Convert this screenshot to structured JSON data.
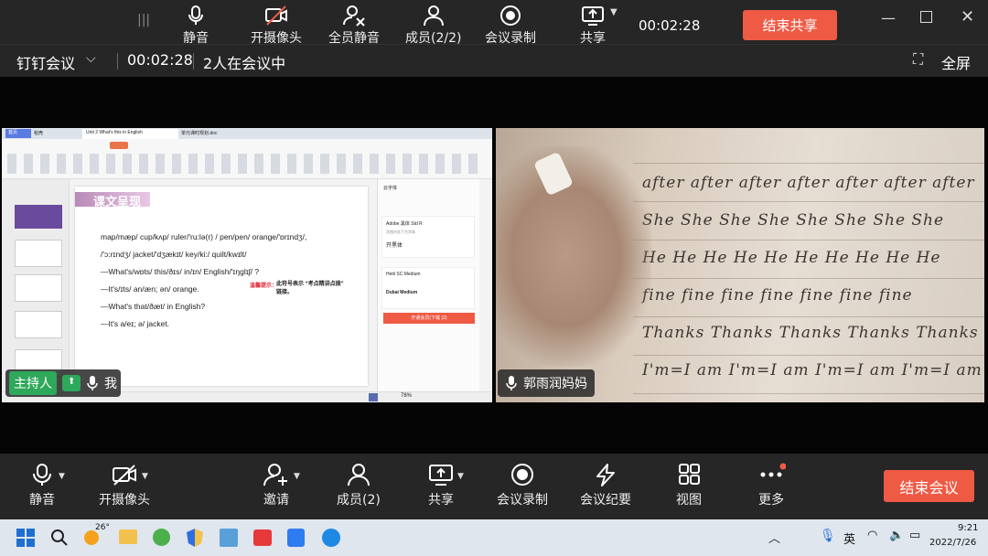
{
  "top_toolbar": {
    "items": [
      {
        "label": "静音",
        "icon": "microphone-icon"
      },
      {
        "label": "开摄像头",
        "icon": "camera-off-icon"
      },
      {
        "label": "全员静音",
        "icon": "mute-all-icon"
      },
      {
        "label": "成员(2/2)",
        "icon": "members-icon"
      },
      {
        "label": "会议录制",
        "icon": "record-icon"
      },
      {
        "label": "共享",
        "icon": "share-screen-icon"
      }
    ],
    "timer": "00:02:28",
    "end_share_label": "结束共享"
  },
  "info_bar": {
    "app_name": "钉钉会议",
    "duration": "00:02:28",
    "participants": "2人在会议中",
    "fullscreen_label": "全屏"
  },
  "shared_screen": {
    "tabs": [
      "首页",
      "稻壳",
      "Unit 2 What's this in English",
      "单元课时规划.doc"
    ],
    "slide_title": "课文呈现",
    "slide_lines": [
      "map/mæp/  cup/kʌp/  ruler/'ru:lə(r) /  pen/pen/  orange/'ɒrɪndʒ/,",
      "/'ɔ:rɪndʒ/  jacket/'dʒækɪt/  key/ki:/  quilt/kwɪlt/",
      "—What's/wɒts/ this/ðɪs/ in/ɪn/ English/'ɪŋɡlɪʃ/ ?",
      "—It's/ɪts/ an/æn; ən/ orange.",
      "—What's that/ðæt/ in English?",
      "—It's a/eɪ; ə/ jacket."
    ],
    "tip_title": "温馨提示：",
    "tip_text": "此符号表示 “考点精讲点拨” 链接。",
    "side_panel": {
      "title": "云字体",
      "font1": "Adobe 黑体 Std R",
      "font1_sub": "文档内含下方字体",
      "font1_tag": "开黑体",
      "font2": "Heiti SC Medium",
      "font2_sub": "Dubai Medium",
      "button": "开通会员(下载 (2)"
    },
    "zoom": "78%",
    "host_chip": {
      "role": "主持人",
      "me": "我"
    }
  },
  "camera_tile": {
    "participant_name": "郭雨润妈妈",
    "handwriting_lines": [
      "after after after after after after after",
      "She She She She She She She She",
      "He He He He He He He He He He",
      "fine fine fine fine fine fine fine",
      "Thanks Thanks Thanks Thanks Thanks Thanks",
      "I'm=I am  I'm=I am  I'm=I am  I'm=I am"
    ]
  },
  "bottom_toolbar": {
    "items": [
      {
        "label": "静音",
        "icon": "microphone-icon"
      },
      {
        "label": "开摄像头",
        "icon": "camera-off-icon"
      },
      {
        "label": "邀请",
        "icon": "invite-icon"
      },
      {
        "label": "成员(2)",
        "icon": "members-icon"
      },
      {
        "label": "共享",
        "icon": "share-screen-icon"
      },
      {
        "label": "会议录制",
        "icon": "record-icon"
      },
      {
        "label": "会议纪要",
        "icon": "notes-icon"
      },
      {
        "label": "视图",
        "icon": "grid-view-icon"
      },
      {
        "label": "更多",
        "icon": "more-icon"
      }
    ],
    "end_meeting_label": "结束会议"
  },
  "taskbar": {
    "weather": "26°",
    "ime": "英",
    "time": "9:21",
    "date": "2022/7/26"
  },
  "colors": {
    "accent_red": "#ef5a44",
    "bar_bg": "#262626",
    "taskbar_bg": "#dfe6ee"
  }
}
